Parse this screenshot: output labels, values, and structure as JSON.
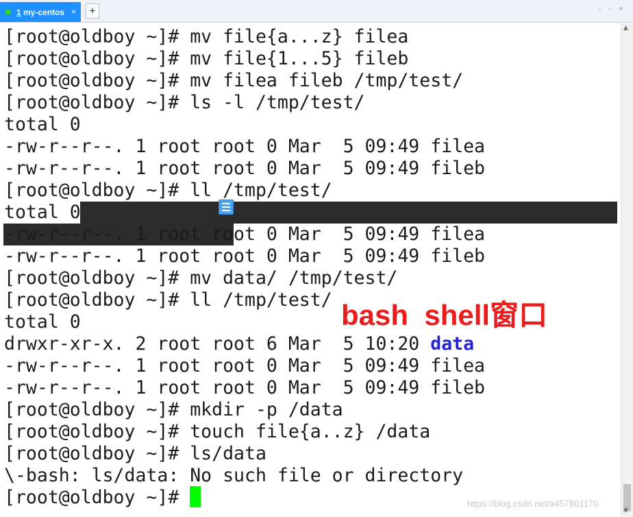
{
  "tab": {
    "number": "1",
    "name": "my-centos",
    "close": "×",
    "add": "+"
  },
  "nav": {
    "left": "‹",
    "right": "›",
    "menu": "▾"
  },
  "terminal_lines": [
    "[root@oldboy ~]# mv file{a...z} filea",
    "[root@oldboy ~]# mv file{1...5} fileb",
    "[root@oldboy ~]# mv filea fileb /tmp/test/",
    "[root@oldboy ~]# ls -l /tmp/test/",
    "total 0",
    "-rw-r--r--. 1 root root 0 Mar  5 09:49 filea",
    "-rw-r--r--. 1 root root 0 Mar  5 09:49 fileb",
    "[root@oldboy ~]# ll /tmp/test/",
    "total 0",
    "-rw-r--r--. 1 root root 0 Mar  5 09:49 filea",
    "-rw-r--r--. 1 root root 0 Mar  5 09:49 fileb",
    "[root@oldboy ~]# mv data/ /tmp/test/",
    "[root@oldboy ~]# ll /tmp/test/",
    "total 0",
    "drwxr-xr-x. 2 root root 6 Mar  5 10:20 ",
    "-rw-r--r--. 1 root root 0 Mar  5 09:49 filea",
    "-rw-r--r--. 1 root root 0 Mar  5 09:49 fileb",
    "[root@oldboy ~]# mkdir -p /data",
    "[root@oldboy ~]# touch file{a..z} /data",
    "[root@oldboy ~]# ls/data",
    "\\-bash: ls/data: No such file or directory",
    "[root@oldboy ~]# "
  ],
  "dir_name": "data",
  "caption": "bash  shell窗口",
  "watermark": "https://blog.csdn.net/a457801170",
  "colors": {
    "tab": "#1e90ff",
    "cursor": "#00ff00",
    "caption": "#e81d1d",
    "dir": "#2424d4",
    "selection": "#2b2b2b"
  }
}
